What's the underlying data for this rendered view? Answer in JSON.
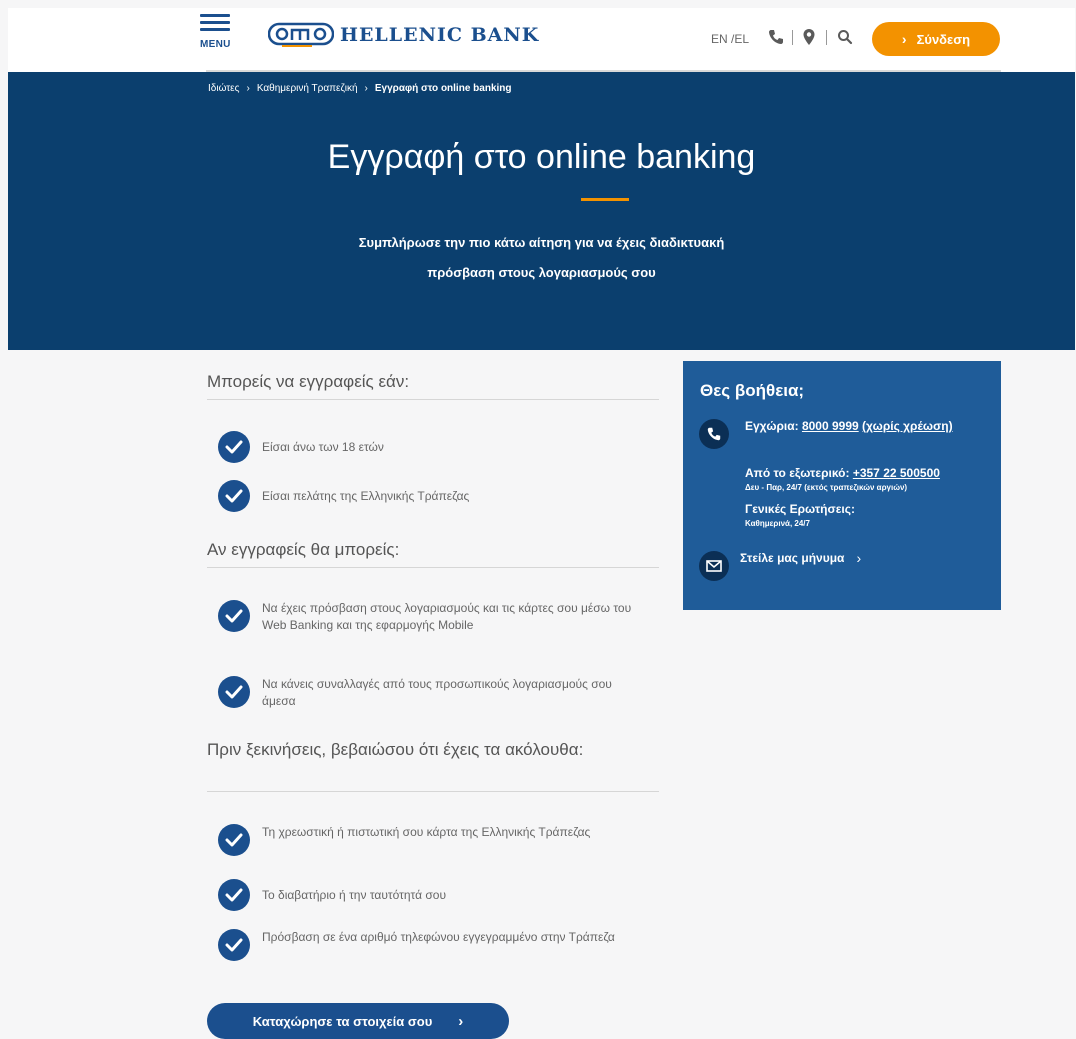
{
  "header": {
    "menu_label": "MENU",
    "brand_name": "HELLENIC BANK",
    "lang_switch": "EN /EL",
    "login_label": "Σύνδεση",
    "icons": [
      "phone-icon",
      "location-pin-icon",
      "search-icon"
    ],
    "accent_color": "#f39200",
    "brand_color": "#1b4f8e"
  },
  "breadcrumb": [
    "Ιδιώτες",
    "Καθημερινή Τραπεζική",
    "Εγγραφή στο online banking"
  ],
  "hero": {
    "title": "Εγγραφή στο online banking",
    "subtitle_line1": "Συμπλήρωσε την πιο κάτω αίτηση για να έχεις διαδικτυακή",
    "subtitle_line2": "πρόσβαση στους λογαριασμούς σου",
    "background_color": "#0b3f6e"
  },
  "sections": [
    {
      "title": "Μπορείς να εγγραφείς εάν:",
      "items": [
        "Είσαι άνω των 18 ετών",
        "Είσαι πελάτης της Ελληνικής Τράπεζας"
      ]
    },
    {
      "title": "Αν εγγραφείς θα μπορείς:",
      "items": [
        "Να έχεις πρόσβαση στους λογαριασμούς και τις κάρτες σου μέσω του Web Banking και της εφαρμογής Mobile",
        "Να κάνεις συναλλαγές από τους προσωπικούς λογαριασμούς σου άμεσα"
      ]
    },
    {
      "title": "Πριν ξεκινήσεις, βεβαιώσου ότι έχεις τα ακόλουθα:",
      "items": [
        "Τη χρεωστική ή πιστωτική σου κάρτα της Ελληνικής Τράπεζας",
        "Το διαβατήριο ή την ταυτότητά σου",
        "Πρόσβαση σε ένα αριθμό τηλεφώνου εγγεγραμμένο στην Τράπεζα"
      ]
    }
  ],
  "cta_label": "Καταχώρησε τα στοιχεία σου",
  "help": {
    "title": "Θες βοήθεια;",
    "local_label": "Εγχώρια:",
    "local_number": "8000 9999",
    "local_note": "(χωρίς χρέωση)",
    "abroad_label": "Από το εξωτερικό:",
    "abroad_number": "+357 22 500500",
    "abroad_hours": "Δευ - Παρ, 24/7 (εκτός τραπεζικών αργιών)",
    "general_label": "Γενικές Ερωτήσεις:",
    "general_hours": "Καθημερινά, 24/7",
    "message_label": "Στείλε μας μήνυμα",
    "background_color": "#1f5c99"
  }
}
